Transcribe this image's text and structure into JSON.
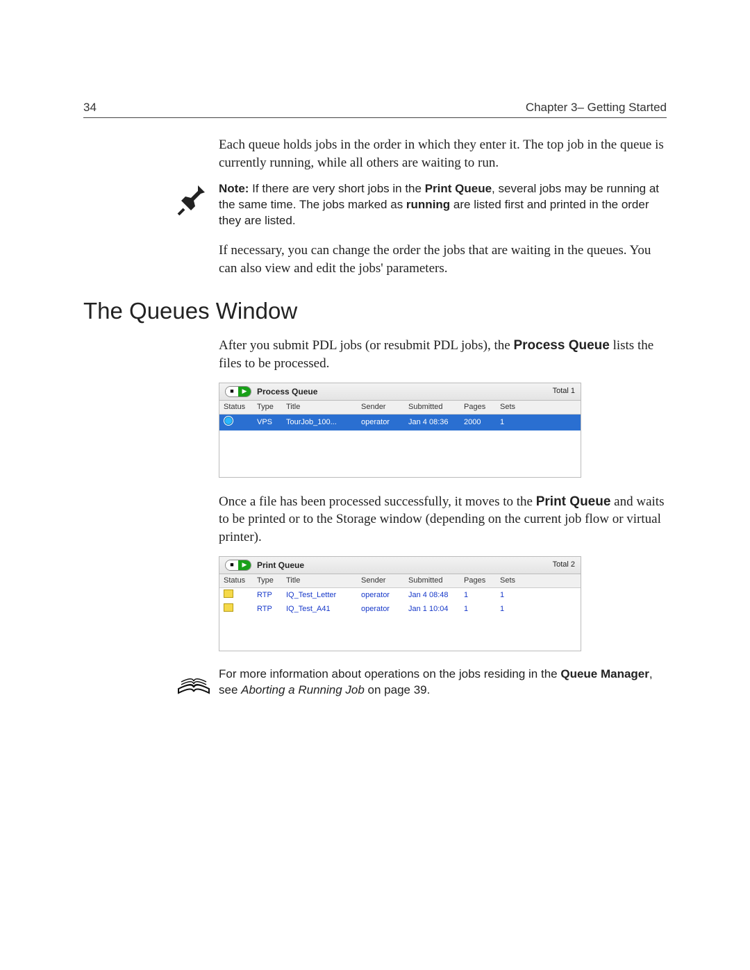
{
  "header": {
    "page_number": "34",
    "chapter": "Chapter 3– Getting Started"
  },
  "body": {
    "intro_para": "Each queue holds jobs in the order in which they enter it. The top job in the queue is currently running, while all others are waiting to run.",
    "note": {
      "label": "Note:",
      "t1": "  If there are very short jobs in the ",
      "pq": "Print Queue",
      "t2": ", several jobs may be running at the same time. The jobs marked as ",
      "run": "running",
      "t3": " are listed first and printed in the order they are listed."
    },
    "para2": "If necessary, you can change the order the jobs that are waiting in the queues. You can also view and edit the jobs' parameters."
  },
  "section_heading": "The Queues Window",
  "section": {
    "p1_a": "After you submit PDL jobs (or resubmit PDL jobs), the ",
    "p1_b": "Process Queue",
    "p1_c": " lists the files to be processed.",
    "p2_a": "Once a file has been processed successfully, it moves to the ",
    "p2_b": "Print Queue",
    "p2_c": " and waits to be printed or to the Storage window (depending on the current job flow or virtual printer).",
    "ref_a": "For more information about operations on the jobs residing in the ",
    "ref_b": "Queue Manager",
    "ref_c": ", see ",
    "ref_d": "Aborting a Running Job",
    "ref_e": " on page 39."
  },
  "process_queue": {
    "title": "Process Queue",
    "total": "Total 1",
    "columns": [
      "Status",
      "Type",
      "Title",
      "Sender",
      "Submitted",
      "Pages",
      "Sets"
    ],
    "rows": [
      {
        "selected": true,
        "status_icon": "run",
        "type": "VPS",
        "title": "TourJob_100...",
        "sender": "operator",
        "submitted": "Jan 4 08:36",
        "pages": "2000",
        "sets": "1"
      }
    ]
  },
  "print_queue": {
    "title": "Print Queue",
    "total": "Total 2",
    "columns": [
      "Status",
      "Type",
      "Title",
      "Sender",
      "Submitted",
      "Pages",
      "Sets"
    ],
    "rows": [
      {
        "selected": false,
        "status_icon": "printer",
        "type": "RTP",
        "title": "IQ_Test_Letter",
        "sender": "operator",
        "submitted": "Jan 4 08:48",
        "pages": "1",
        "sets": "1"
      },
      {
        "selected": false,
        "status_icon": "printer",
        "type": "RTP",
        "title": "IQ_Test_A41",
        "sender": "operator",
        "submitted": "Jan 1 10:04",
        "pages": "1",
        "sets": "1"
      }
    ]
  }
}
